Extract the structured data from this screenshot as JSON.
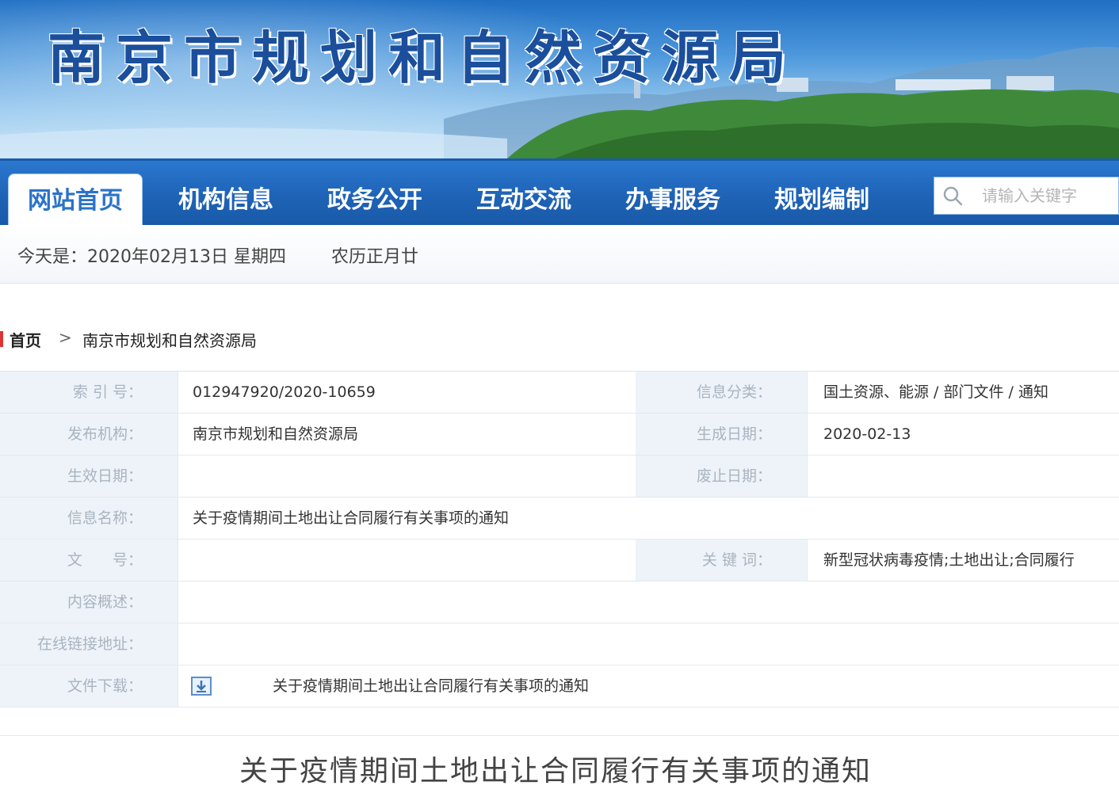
{
  "banner": {
    "title": "南京市规划和自然资源局"
  },
  "nav": {
    "items": [
      {
        "label": "网站首页",
        "active": true
      },
      {
        "label": "机构信息",
        "active": false
      },
      {
        "label": "政务公开",
        "active": false
      },
      {
        "label": "互动交流",
        "active": false
      },
      {
        "label": "办事服务",
        "active": false
      },
      {
        "label": "规划编制",
        "active": false
      }
    ],
    "search_placeholder": "请输入关键字",
    "search_icon": "search-icon"
  },
  "datebar": {
    "today": "今天是：2020年02月13日 星期四",
    "lunar": "农历正月廿"
  },
  "breadcrumb": {
    "home": "首页",
    "separator": ">",
    "current": "南京市规划和自然资源局"
  },
  "meta": {
    "index_no_label": "索 引 号：",
    "index_no": "012947920/2020-10659",
    "category_label": "信息分类：",
    "category": "国土资源、能源 / 部门文件 / 通知",
    "publisher_label": "发布机构：",
    "publisher": "南京市规划和自然资源局",
    "generated_label": "生成日期：",
    "generated": "2020-02-13",
    "effective_label": "生效日期：",
    "effective": "",
    "expiry_label": "废止日期：",
    "expiry": "",
    "name_label": "信息名称：",
    "name": "关于疫情期间土地出让合同履行有关事项的通知",
    "doc_no_label": "文　　号：",
    "doc_no": "",
    "keywords_label": "关 键 词：",
    "keywords": "新型冠状病毒疫情;土地出让;合同履行",
    "summary_label": "内容概述：",
    "summary": "",
    "link_label": "在线链接地址：",
    "link": "",
    "download_label": "文件下载：",
    "download_icon": "download-icon",
    "download_file": "关于疫情期间土地出让合同履行有关事项的通知"
  },
  "article": {
    "title": "关于疫情期间土地出让合同履行有关事项的通知"
  },
  "colors": {
    "nav_bg": "#1f63b6",
    "nav_active_text": "#2b73c8",
    "label_bg": "#eef3f9",
    "title_blue": "#1b4e9b"
  }
}
